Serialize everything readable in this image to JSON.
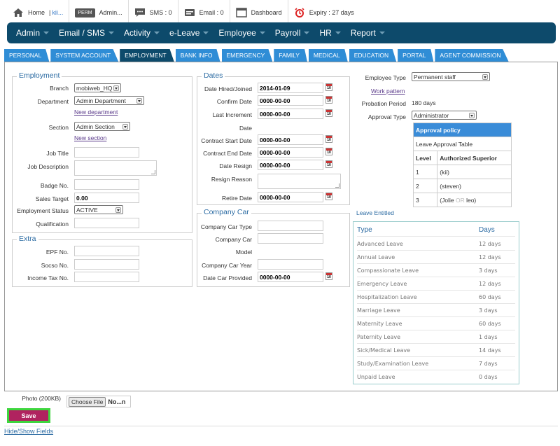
{
  "topbar": {
    "home_label": "Home",
    "home_sep": "|",
    "home_user": "kii...",
    "perm_badge": "PERM",
    "perm_label": "Admin...",
    "sms_label": "SMS : 0",
    "email_label": "Email : 0",
    "dashboard_label": "Dashboard",
    "expiry_label": "Expiry : 27 days"
  },
  "nav": [
    {
      "label": "Admin"
    },
    {
      "label": "Email / SMS"
    },
    {
      "label": "Activity"
    },
    {
      "label": "e-Leave"
    },
    {
      "label": "Employee"
    },
    {
      "label": "Payroll"
    },
    {
      "label": "HR"
    },
    {
      "label": "Report"
    }
  ],
  "tabs": [
    {
      "label": "PERSONAL"
    },
    {
      "label": "SYSTEM ACCOUNT"
    },
    {
      "label": "EMPLOYMENT"
    },
    {
      "label": "BANK INFO"
    },
    {
      "label": "EMERGENCY"
    },
    {
      "label": "FAMILY"
    },
    {
      "label": "MEDICAL"
    },
    {
      "label": "EDUCATION"
    },
    {
      "label": "PORTAL"
    },
    {
      "label": "AGENT COMMISSION"
    }
  ],
  "active_tab": "EMPLOYMENT",
  "employment": {
    "legend": "Employment",
    "branch_label": "Branch",
    "branch_value": "mobiweb_HQ",
    "department_label": "Department",
    "department_value": "Admin Department",
    "new_department": "New department",
    "section_label": "Section",
    "section_value": "Admin Section",
    "new_section": "New section",
    "job_title_label": "Job Title",
    "job_title_value": "",
    "job_description_label": "Job Description",
    "badge_label": "Badge No.",
    "badge_value": "",
    "sales_target_label": "Sales Target",
    "sales_target_value": "0.00",
    "status_label": "Employment Status",
    "status_value": "ACTIVE",
    "qualification_label": "Qualification",
    "qualification_value": ""
  },
  "extra": {
    "legend": "Extra",
    "epf_label": "EPF No.",
    "socso_label": "Socso No.",
    "income_tax_label": "Income Tax No."
  },
  "dates": {
    "legend": "Dates",
    "hired_label": "Date Hired/Joined",
    "hired_value": "2014-01-09",
    "confirm_label": "Confirm Date",
    "confirm_value": "0000-00-00",
    "increment_label_1": "Last Increment",
    "increment_label_2": "Date",
    "increment_value": "0000-00-00",
    "contract_start_label": "Contract Start Date",
    "contract_start_value": "0000-00-00",
    "contract_end_label": "Contract End Date",
    "contract_end_value": "0000-00-00",
    "resign_label": "Date Resign",
    "resign_value": "0000-00-00",
    "resign_reason_label": "Resign Reason",
    "retire_label": "Retire Date",
    "retire_value": "0000-00-00"
  },
  "company_car": {
    "legend": "Company Car",
    "type_label": "Company Car Type",
    "model_label_1": "Company Car",
    "model_label_2": "Model",
    "year_label": "Company Car Year",
    "date_provided_label": "Date Car Provided",
    "date_provided_value": "0000-00-00"
  },
  "right": {
    "employee_type_label": "Employee Type",
    "employee_type_value": "Permanent staff",
    "work_pattern": "Work pattern",
    "probation_label": "Probation Period",
    "probation_value": "180 days",
    "approval_type_label": "Approval Type",
    "approval_type_value": "Administrator",
    "approval_policy_title": "Approval policy",
    "leave_approval_table": "Leave Approval Table",
    "level_header": "Level",
    "superior_header": "Authorized Superior",
    "approval_rows": [
      {
        "level": "1",
        "superior": "(kii)"
      },
      {
        "level": "2",
        "superior": "(steven)"
      },
      {
        "level": "3",
        "superior_a": "(Jolie",
        "or": "OR",
        "superior_b": "leo)"
      }
    ]
  },
  "leave": {
    "title": "Leave Entitled",
    "type_header": "Type",
    "days_header": "Days",
    "rows": [
      {
        "type": "Advanced Leave",
        "days": "12 days"
      },
      {
        "type": "Annual Leave",
        "days": "12 days"
      },
      {
        "type": "Compassionate Leave",
        "days": "3 days"
      },
      {
        "type": "Emergency Leave",
        "days": "12 days"
      },
      {
        "type": "Hospitalization Leave",
        "days": "60 days"
      },
      {
        "type": "Marriage Leave",
        "days": "3 days"
      },
      {
        "type": "Maternity Leave",
        "days": "60 days"
      },
      {
        "type": "Paternity Leave",
        "days": "1 days"
      },
      {
        "type": "Sick/Medical Leave",
        "days": "14 days"
      },
      {
        "type": "Study/Examination Leave",
        "days": "7 days"
      },
      {
        "type": "Unpaid Leave",
        "days": "0 days"
      }
    ]
  },
  "photo": {
    "label": "Photo (200KB)",
    "choose_button": "Choose File",
    "file_name": "No...n"
  },
  "save_label": "Save",
  "hide_show_label": "Hide/Show Fields"
}
